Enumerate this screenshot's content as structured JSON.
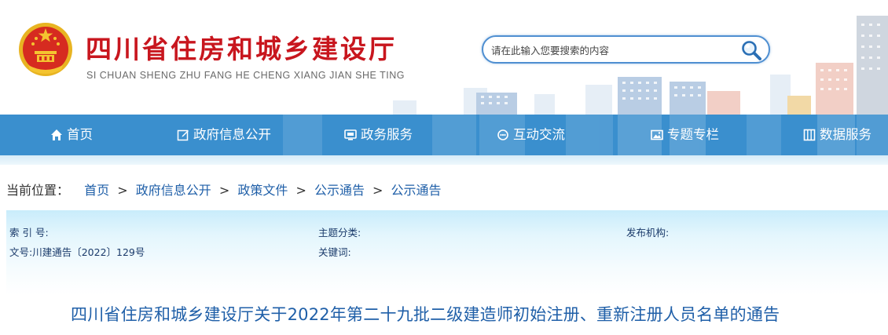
{
  "site": {
    "title": "四川省住房和城乡建设厅",
    "pinyin": "SI CHUAN SHENG ZHU FANG HE CHENG XIANG JIAN SHE TING",
    "brand_red": "#c8161e",
    "nav_blue": "#3a8fce"
  },
  "search": {
    "placeholder": "请在此输入您要搜索的内容",
    "icon": "search-icon"
  },
  "nav": {
    "items": [
      {
        "label": "首页",
        "icon": "home-icon"
      },
      {
        "label": "政府信息公开",
        "icon": "edit-icon"
      },
      {
        "label": "政务服务",
        "icon": "monitor-icon"
      },
      {
        "label": "互动交流",
        "icon": "chat-icon"
      },
      {
        "label": "专题专栏",
        "icon": "image-icon"
      },
      {
        "label": "数据服务",
        "icon": "grid-icon"
      }
    ]
  },
  "breadcrumb": {
    "label": "当前位置：",
    "items": [
      "首页",
      "政府信息公开",
      "政策文件",
      "公示通告",
      "公示通告"
    ],
    "separator": ">"
  },
  "info": {
    "index_label": "索 引 号:",
    "topic_label": "主题分类:",
    "publisher_label": "发布机构:",
    "doc_no_label": "文号:",
    "doc_no_value": "川建通告〔2022〕129号",
    "keywords_label": "关键词:"
  },
  "document": {
    "title": "四川省住房和城乡建设厅关于2022年第二十九批二级建造师初始注册、重新注册人员名单的通告"
  }
}
